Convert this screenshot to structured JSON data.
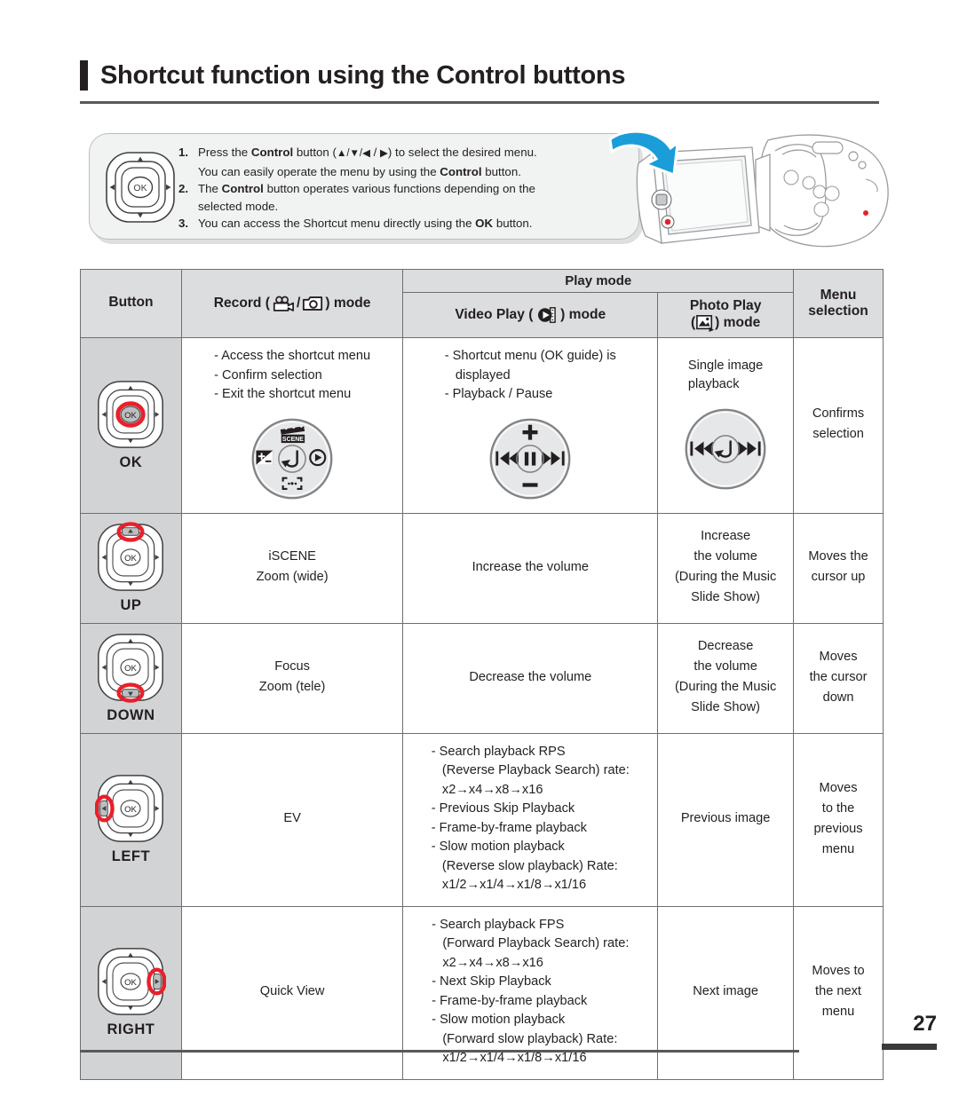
{
  "page": {
    "title": "Shortcut function using the Control buttons",
    "number": "27"
  },
  "info_box": {
    "icon": "control-pad-icon",
    "items": [
      {
        "num": "1.",
        "parts": [
          {
            "t": "Press the ",
            "b": false
          },
          {
            "t": "Control",
            "b": true
          },
          {
            "t": " button (▲/▼/◀ / ▶) to select the desired menu.",
            "b": false
          },
          {
            "t": "\nYou can easily operate the menu by using the ",
            "b": false
          },
          {
            "t": "Control",
            "b": true
          },
          {
            "t": " button.",
            "b": false
          }
        ],
        "text": "Press the Control button (▲/▼/◀ / ▶) to select the desired menu. You can easily operate the menu by using the Control button."
      },
      {
        "num": "2.",
        "text": "The Control button operates various functions depending on the selected mode."
      },
      {
        "num": "3.",
        "text": "You can access the Shortcut menu directly using the OK button."
      }
    ]
  },
  "illustration": {
    "name": "camcorder-with-open-lcd",
    "arrow": "blue-curved-arrow"
  },
  "table": {
    "headers": {
      "button": "Button",
      "record": "Record (",
      "record_suffix": ") mode",
      "record_icon_a": "video-camera-icon",
      "record_icon_b": "photo-camera-icon",
      "play_mode": "Play mode",
      "video_play_prefix": "Video Play ( ",
      "video_play_suffix": " ) mode",
      "video_play_icon": "video-play-icon",
      "photo_play_line1": "Photo Play",
      "photo_play_line2": ") mode",
      "photo_play_icon": "photo-play-icon",
      "menu_selection_line1": "Menu",
      "menu_selection_line2": "selection"
    },
    "rows": [
      {
        "button": "OK",
        "button_icon": "control-pad-ok-highlighted-icon",
        "record": {
          "lines": [
            "- Access the shortcut menu",
            "- Confirm selection",
            "- Exit the shortcut menu"
          ],
          "wheel": "record-shortcut-wheel-icon"
        },
        "video": {
          "lines": [
            "- Shortcut menu (OK guide) is",
            "   displayed",
            "- Playback / Pause"
          ],
          "wheel": "video-playback-wheel-icon"
        },
        "photo": {
          "lines": [
            "Single image",
            "playback"
          ],
          "wheel": "photo-playback-wheel-icon"
        },
        "menu": {
          "lines": [
            "Confirms",
            "selection"
          ]
        }
      },
      {
        "button": "UP",
        "button_icon": "control-pad-up-highlighted-icon",
        "record": {
          "lines": [
            "iSCENE",
            "Zoom (wide)"
          ]
        },
        "video": {
          "lines": [
            "Increase the volume"
          ]
        },
        "photo": {
          "lines": [
            "Increase",
            "the volume",
            "(During the Music",
            "Slide Show)"
          ]
        },
        "menu": {
          "lines": [
            "Moves the",
            "cursor up"
          ]
        }
      },
      {
        "button": "DOWN",
        "button_icon": "control-pad-down-highlighted-icon",
        "record": {
          "lines": [
            "Focus",
            "Zoom (tele)"
          ]
        },
        "video": {
          "lines": [
            "Decrease the volume"
          ]
        },
        "photo": {
          "lines": [
            "Decrease",
            "the volume",
            "(During the Music",
            "Slide Show)"
          ]
        },
        "menu": {
          "lines": [
            "Moves",
            "the cursor",
            "down"
          ]
        }
      },
      {
        "button": "LEFT",
        "button_icon": "control-pad-left-highlighted-icon",
        "record": {
          "lines": [
            "EV"
          ]
        },
        "video": {
          "lines": [
            "- Search playback RPS",
            "   (Reverse Playback Search) rate:",
            "   x2→x4→x8→x16",
            "- Previous Skip Playback",
            "- Frame-by-frame playback",
            "- Slow motion playback",
            "   (Reverse slow playback) Rate:",
            "   x1/2→x1/4→x1/8→x1/16"
          ]
        },
        "photo": {
          "lines": [
            "Previous image"
          ]
        },
        "menu": {
          "lines": [
            "Moves",
            "to the",
            "previous",
            "menu"
          ]
        }
      },
      {
        "button": "RIGHT",
        "button_icon": "control-pad-right-highlighted-icon",
        "record": {
          "lines": [
            "Quick View"
          ]
        },
        "video": {
          "lines": [
            "- Search playback FPS",
            "   (Forward Playback Search) rate:",
            "   x2→x4→x8→x16",
            "- Next Skip Playback",
            "- Frame-by-frame playback",
            "- Slow motion playback",
            "   (Forward slow playback) Rate:",
            "   x1/2→x1/4→x1/8→x1/16"
          ]
        },
        "photo": {
          "lines": [
            "Next image"
          ]
        },
        "menu": {
          "lines": [
            "Moves to",
            "the next",
            "menu"
          ]
        }
      }
    ]
  },
  "colors": {
    "ink": "#231f20",
    "highlight_red": "#e8202a",
    "header_fill": "#dcdddf",
    "button_col_fill": "#d2d3d5",
    "arrow_blue": "#1b9dd9",
    "rule": "#58595b"
  }
}
